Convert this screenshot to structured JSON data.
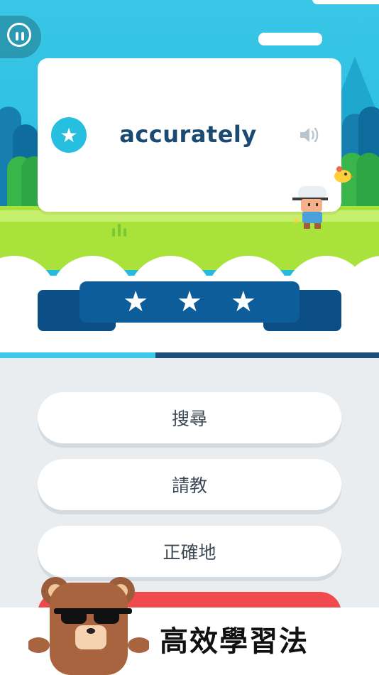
{
  "game": {
    "word": "accurately",
    "rating_stars": 3,
    "progress_fraction": 0.41,
    "answers": [
      {
        "label": "搜尋"
      },
      {
        "label": "請教"
      },
      {
        "label": "正確地"
      }
    ]
  },
  "footer": {
    "tagline": "高效學習法"
  },
  "icons": {
    "pause": "pause-icon",
    "favorite": "star-icon",
    "audio": "speaker-icon",
    "mascot": "bear-with-sunglasses"
  },
  "colors": {
    "sky": "#2ab9dd",
    "grass": "#a8e23a",
    "ribbon": "#0c5d99",
    "word": "#1b4a73",
    "accent_cyan": "#27bfe0",
    "answer_red": "#f04a4f"
  }
}
